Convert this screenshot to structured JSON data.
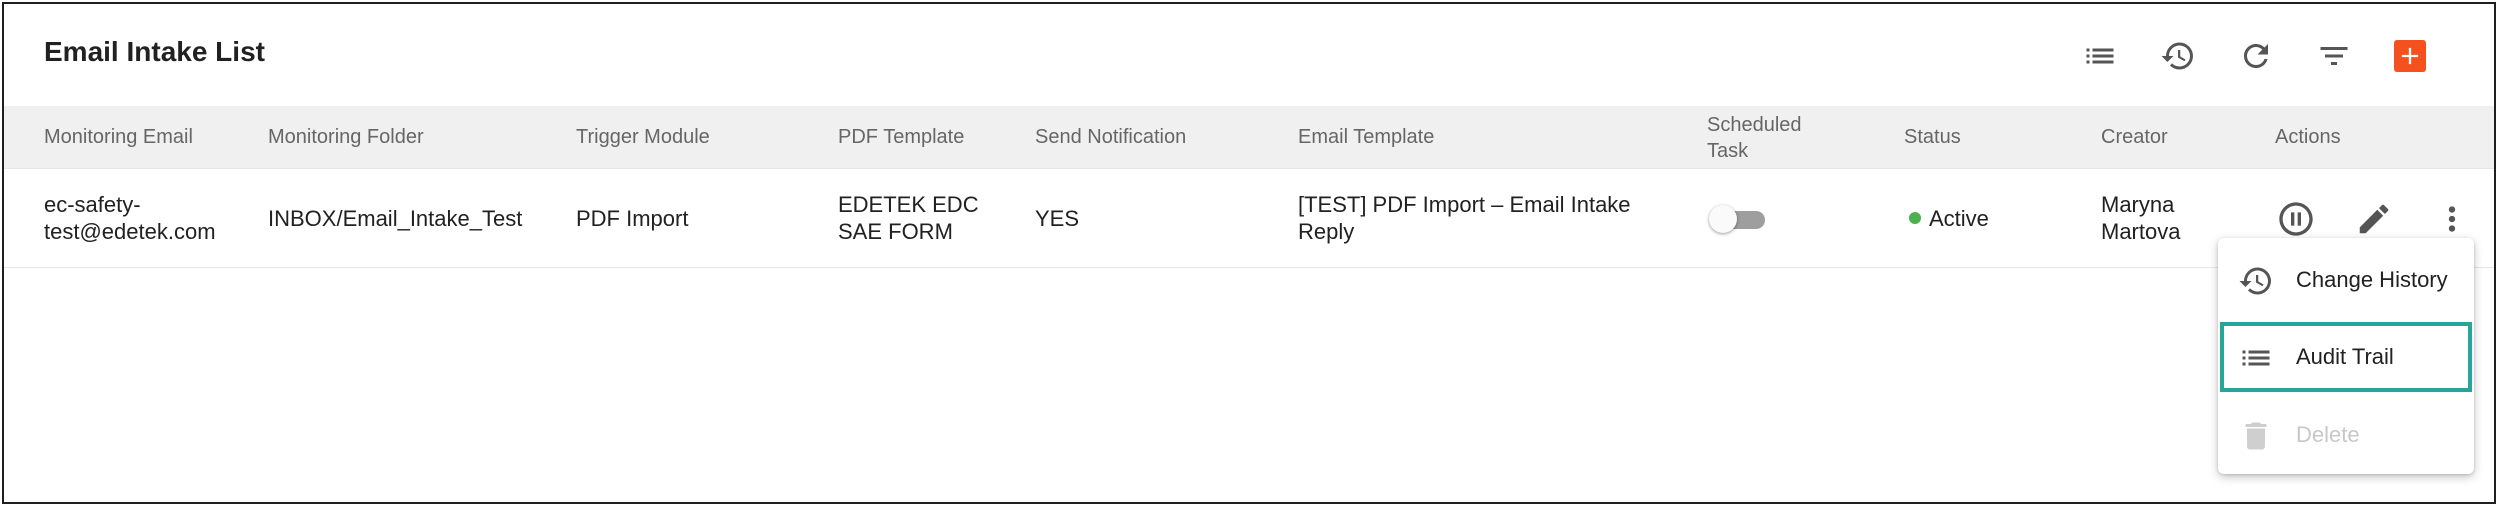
{
  "page": {
    "title": "Email Intake List"
  },
  "toolbar": {
    "icons": [
      "list-icon",
      "history-icon",
      "refresh-icon",
      "filter-icon",
      "add-icon"
    ],
    "accent_color": "#f4511e"
  },
  "table": {
    "columns": {
      "monitoring_email": "Monitoring Email",
      "monitoring_folder": "Monitoring Folder",
      "trigger_module": "Trigger Module",
      "pdf_template": "PDF Template",
      "send_notification": "Send Notification",
      "email_template": "Email Template",
      "scheduled_task_line1": "Scheduled",
      "scheduled_task_line2": "Task",
      "status": "Status",
      "creator": "Creator",
      "actions": "Actions"
    },
    "rows": [
      {
        "monitoring_email_line1": "ec-safety-",
        "monitoring_email_line2": "test@edetek.com",
        "monitoring_folder": "INBOX/Email_Intake_Test",
        "trigger_module": "PDF Import",
        "pdf_template_line1": "EDETEK EDC",
        "pdf_template_line2": "SAE FORM",
        "send_notification": "YES",
        "email_template_line1": "[TEST] PDF Import – Email Intake",
        "email_template_line2": "Reply",
        "scheduled_task": false,
        "status": "Active",
        "status_color": "#4caf50",
        "creator_line1": "Maryna",
        "creator_line2": "Martova"
      }
    ]
  },
  "context_menu": {
    "items": [
      {
        "label": "Change History",
        "icon": "history-icon",
        "disabled": false
      },
      {
        "label": "Audit Trail",
        "icon": "list-icon",
        "disabled": false,
        "highlighted": true
      },
      {
        "label": "Delete",
        "icon": "trash-icon",
        "disabled": true
      }
    ],
    "highlight_color": "#26a69a"
  }
}
